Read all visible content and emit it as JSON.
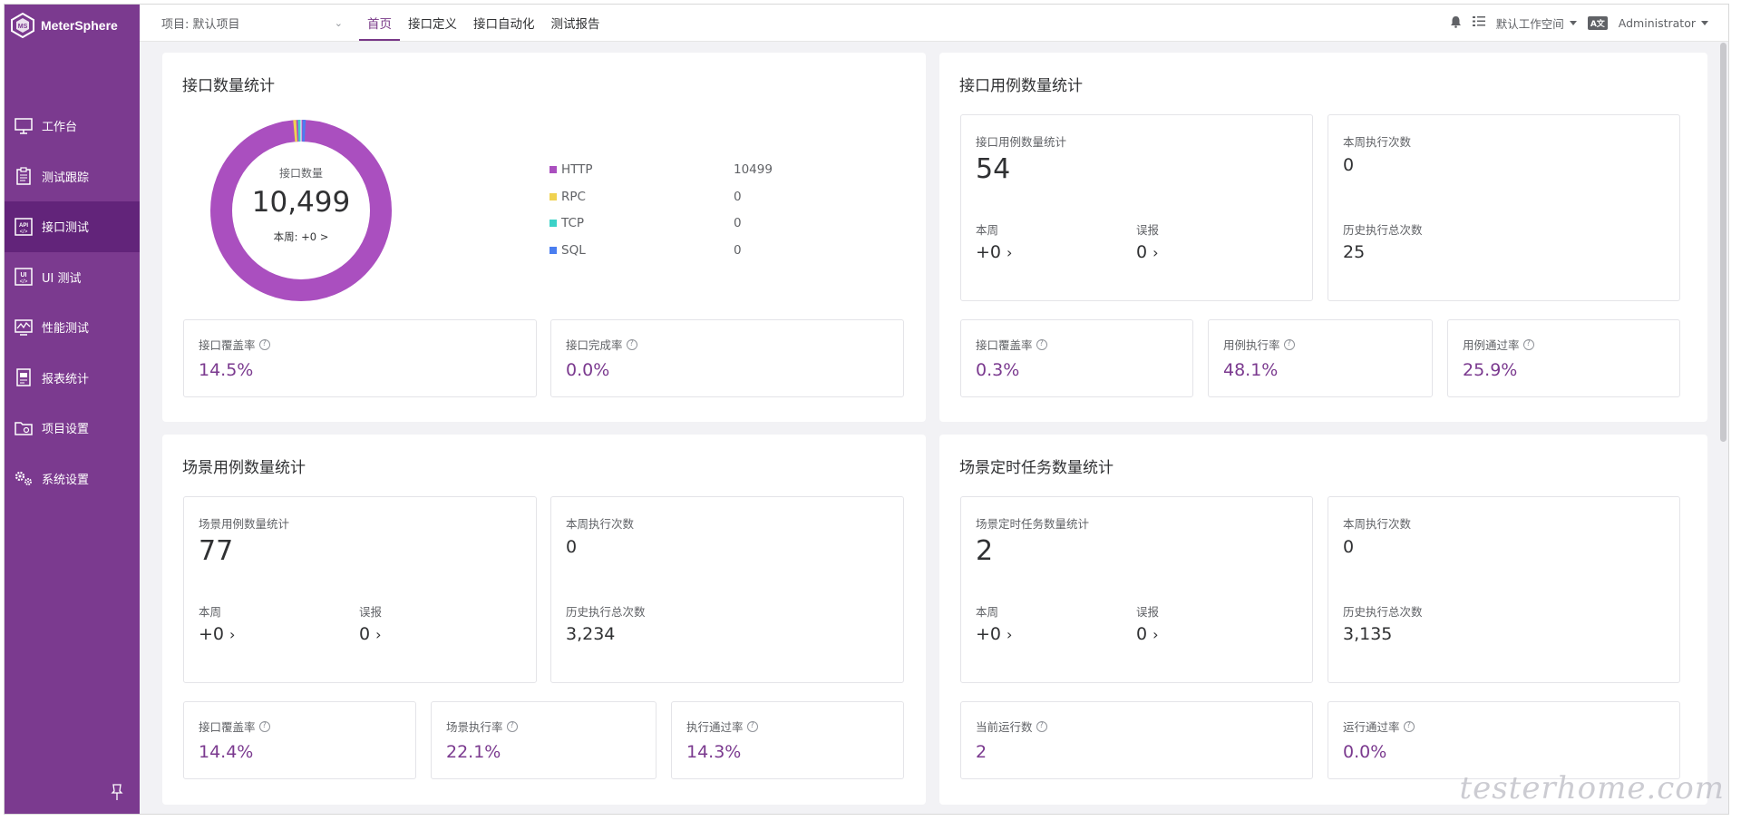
{
  "brand": {
    "name": "MeterSphere",
    "accent": "#783887",
    "sidebar_bg": "#7b3a8f"
  },
  "header": {
    "project": "项目: 默认项目",
    "menu": [
      "首页",
      "接口定义",
      "接口自动化",
      "测试报告"
    ],
    "workspace": "默认工作空间",
    "lang": "A文",
    "user": "Administrator"
  },
  "sidebar": {
    "items": [
      {
        "label": "工作台",
        "icon": "monitor-icon"
      },
      {
        "label": "测试跟踪",
        "icon": "clipboard-icon"
      },
      {
        "label": "接口测试",
        "icon": "api-icon"
      },
      {
        "label": "UI 测试",
        "icon": "ui-icon"
      },
      {
        "label": "性能测试",
        "icon": "performance-icon"
      },
      {
        "label": "报表统计",
        "icon": "report-icon"
      },
      {
        "label": "项目设置",
        "icon": "folder-icon"
      },
      {
        "label": "系统设置",
        "icon": "gear-icon"
      }
    ]
  },
  "api_count": {
    "title": "接口数量统计",
    "center_label": "接口数量",
    "total": "10,499",
    "week": "本周: +0 >",
    "legend": [
      {
        "name": "HTTP",
        "count": "10499",
        "color": "#aa4fbf"
      },
      {
        "name": "RPC",
        "count": "0",
        "color": "#f0d250"
      },
      {
        "name": "TCP",
        "count": "0",
        "color": "#3cd2c8"
      },
      {
        "name": "SQL",
        "count": "0",
        "color": "#4a7ef0"
      }
    ],
    "coverage_label": "接口覆盖率",
    "coverage": "14.5%",
    "completion_label": "接口完成率",
    "completion": "0.0%"
  },
  "case_count": {
    "title": "接口用例数量统计",
    "stat_label": "接口用例数量统计",
    "stat": "54",
    "week_label": "本周",
    "week": "+0",
    "misreport_label": "误报",
    "misreport": "0",
    "exec_week_label": "本周执行次数",
    "exec_week": "0",
    "exec_total_label": "历史执行总次数",
    "exec_total": "25",
    "coverage_label": "接口覆盖率",
    "coverage": "0.3%",
    "exec_rate_label": "用例执行率",
    "exec_rate": "48.1%",
    "pass_rate_label": "用例通过率",
    "pass_rate": "25.9%"
  },
  "scenario_count": {
    "title": "场景用例数量统计",
    "stat_label": "场景用例数量统计",
    "stat": "77",
    "week_label": "本周",
    "week": "+0",
    "misreport_label": "误报",
    "misreport": "0",
    "exec_week_label": "本周执行次数",
    "exec_week": "0",
    "exec_total_label": "历史执行总次数",
    "exec_total": "3,234",
    "coverage_label": "接口覆盖率",
    "coverage": "14.4%",
    "exec_rate_label": "场景执行率",
    "exec_rate": "22.1%",
    "pass_rate_label": "执行通过率",
    "pass_rate": "14.3%"
  },
  "schedule_count": {
    "title": "场景定时任务数量统计",
    "stat_label": "场景定时任务数量统计",
    "stat": "2",
    "week_label": "本周",
    "week": "+0",
    "misreport_label": "误报",
    "misreport": "0",
    "exec_week_label": "本周执行次数",
    "exec_week": "0",
    "exec_total_label": "历史执行总次数",
    "exec_total": "3,135",
    "running_label": "当前运行数",
    "running": "2",
    "pass_rate_label": "运行通过率",
    "pass_rate": "0.0%"
  },
  "watermark": "testerhome.com"
}
